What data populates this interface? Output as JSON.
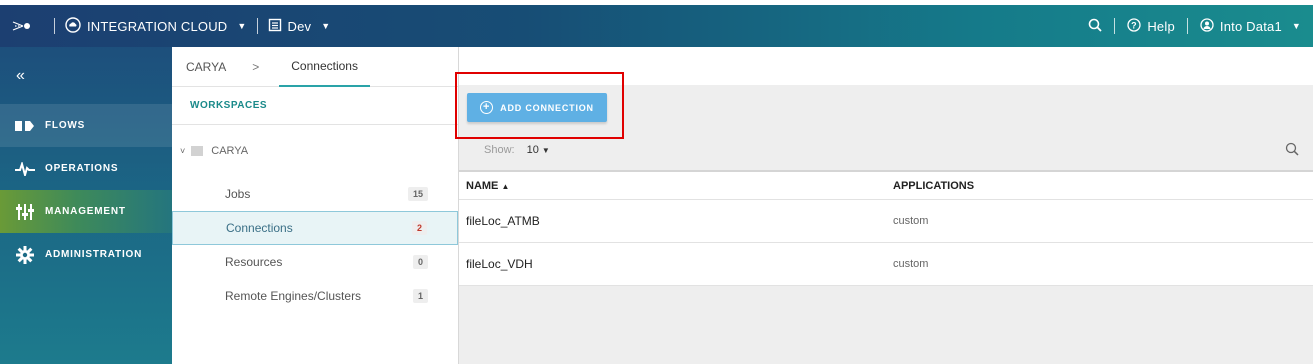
{
  "header": {
    "product": "INTEGRATION CLOUD",
    "environment": "Dev",
    "help": "Help",
    "user": "Into Data1",
    "icons": [
      "logo-icon",
      "cloud-icon",
      "chevron-down-icon",
      "environment-icon",
      "search-icon",
      "help-icon",
      "user-icon"
    ]
  },
  "nav": {
    "collapse_glyph": "«",
    "items": [
      {
        "label": "FLOWS",
        "icon": "flows-icon"
      },
      {
        "label": "OPERATIONS",
        "icon": "pulse-icon"
      },
      {
        "label": "MANAGEMENT",
        "icon": "sliders-icon"
      },
      {
        "label": "ADMINISTRATION",
        "icon": "gear-icon"
      }
    ],
    "active": "MANAGEMENT"
  },
  "breadcrumb": {
    "root": "CARYA",
    "separator": ">",
    "current": "Connections"
  },
  "workspaces": {
    "title": "WORKSPACES",
    "root": "CARYA",
    "items": [
      {
        "label": "Jobs",
        "count": "15"
      },
      {
        "label": "Connections",
        "count": "2"
      },
      {
        "label": "Resources",
        "count": "0"
      },
      {
        "label": "Remote Engines/Clusters",
        "count": "1"
      }
    ],
    "selected": "Connections"
  },
  "main": {
    "add_button": "ADD CONNECTION",
    "show_label": "Show:",
    "show_value": "10",
    "columns": {
      "name": "NAME",
      "sort_indicator": "▲",
      "applications": "APPLICATIONS"
    },
    "rows": [
      {
        "name": "fileLoc_ATMB",
        "applications": "custom"
      },
      {
        "name": "fileLoc_VDH",
        "applications": "custom"
      }
    ]
  },
  "colors": {
    "header_start": "#1c3f71",
    "header_end": "#1a8c8e",
    "accent_teal": "#1a8a8a",
    "button_blue": "#5fb0e4",
    "highlight_red": "#e00000"
  }
}
